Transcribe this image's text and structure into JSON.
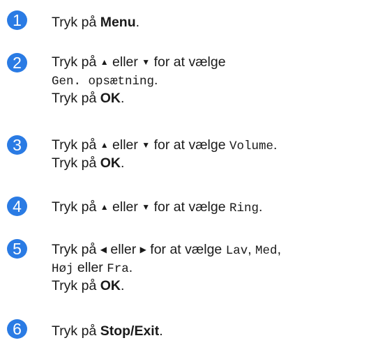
{
  "step1": {
    "num": "1",
    "text_prefix": "Tryk på ",
    "menu": "Menu",
    "period": "."
  },
  "step2": {
    "num": "2",
    "l1_prefix": "Tryk på ",
    "up": "▲",
    "mid": " eller ",
    "down": "▼",
    "l1_suffix": " for at vælge",
    "l2_code": "Gen. opsætning",
    "l2_period": ".",
    "l3_prefix": "Tryk på ",
    "ok": "OK",
    "l3_period": "."
  },
  "step3": {
    "num": "3",
    "l1_prefix": "Tryk på ",
    "up": "▲",
    "mid": " eller ",
    "down": "▼",
    "l1_suffix": " for at vælge ",
    "code": "Volume",
    "l1_period": ".",
    "l2_prefix": "Tryk på ",
    "ok": "OK",
    "l2_period": "."
  },
  "step4": {
    "num": "4",
    "l1_prefix": "Tryk på ",
    "up": "▲",
    "mid": " eller ",
    "down": "▼",
    "l1_suffix": " for at vælge ",
    "code": "Ring",
    "l1_period": "."
  },
  "step5": {
    "num": "5",
    "l1_prefix": "Tryk på ",
    "left": "◀",
    "mid": " eller ",
    "right": "▶",
    "l1_suffix": " for at vælge ",
    "opt_low": "Lav",
    "comma1": ", ",
    "opt_med": "Med",
    "comma2": ",",
    "opt_high": "Høj",
    "l2_or": " eller ",
    "opt_off": "Fra",
    "l2_period": ".",
    "l3_prefix": "Tryk på ",
    "ok": "OK",
    "l3_period": "."
  },
  "step6": {
    "num": "6",
    "text_prefix": "Tryk på ",
    "stop": "Stop/Exit",
    "period": "."
  },
  "colors": {
    "badge": "#2a7be4",
    "text": "#1a1a1a"
  }
}
